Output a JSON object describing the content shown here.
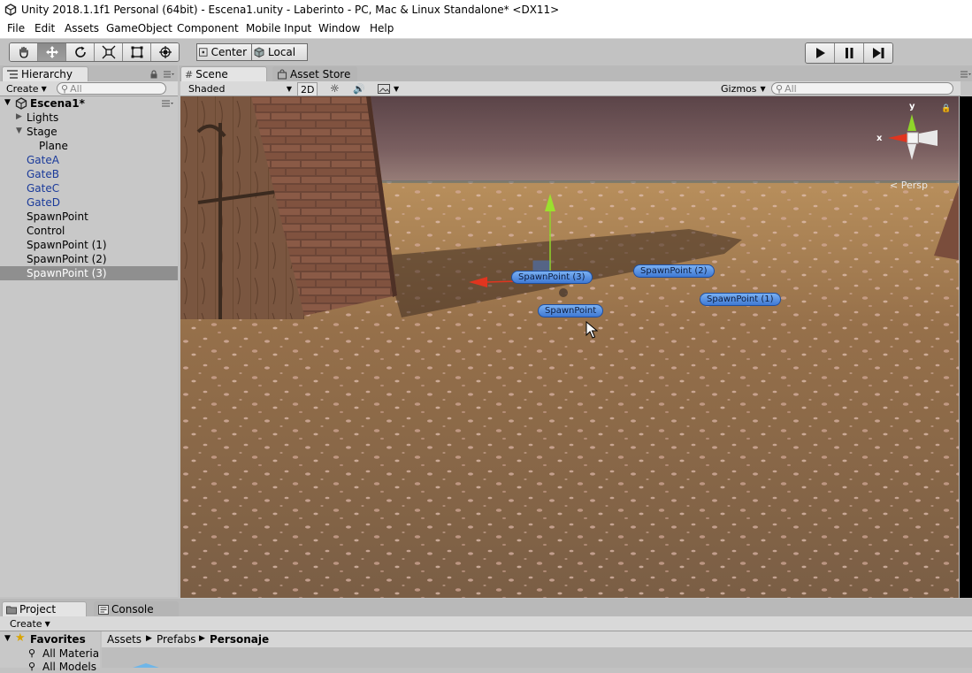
{
  "window": {
    "title": "Unity 2018.1.1f1 Personal (64bit) - Escena1.unity - Laberinto - PC, Mac & Linux Standalone* <DX11>"
  },
  "menu": [
    "File",
    "Edit",
    "Assets",
    "GameObject",
    "Component",
    "Mobile Input",
    "Window",
    "Help"
  ],
  "toolbar": {
    "pivot_mode": "Center",
    "pivot_space": "Local",
    "tools": [
      "hand-tool",
      "move-tool",
      "rotate-tool",
      "scale-tool",
      "rect-tool",
      "transform-tool"
    ],
    "active_tool": "move-tool"
  },
  "hierarchy": {
    "tab": "Hierarchy",
    "create": "Create",
    "search_placeholder": "All",
    "scene": "Escena1*",
    "items": [
      {
        "label": "Lights"
      },
      {
        "label": "Stage"
      },
      {
        "label": "Plane"
      },
      {
        "label": "GateA"
      },
      {
        "label": "GateB"
      },
      {
        "label": "GateC"
      },
      {
        "label": "GateD"
      },
      {
        "label": "SpawnPoint"
      },
      {
        "label": "Control"
      },
      {
        "label": "SpawnPoint (1)"
      },
      {
        "label": "SpawnPoint (2)"
      },
      {
        "label": "SpawnPoint (3)"
      }
    ],
    "selected": "SpawnPoint (3)",
    "prefab_color": "#1a3a9a"
  },
  "scene_view": {
    "tabs": [
      "Scene",
      "Asset Store"
    ],
    "shading": "Shaded",
    "mode_2d": "2D",
    "gizmos": "Gizmos",
    "search_placeholder": "All",
    "projection": "Persp",
    "axis_x": "x",
    "axis_y": "y",
    "spawn_labels": [
      "SpawnPoint (3)",
      "SpawnPoint (2)",
      "SpawnPoint (1)",
      "SpawnPoint"
    ]
  },
  "bottom": {
    "tabs": [
      "Project",
      "Console"
    ],
    "create": "Create",
    "favorites": "Favorites",
    "favorites_items": [
      "All Materials",
      "All Models"
    ],
    "breadcrumb": [
      "Assets",
      "Prefabs",
      "Personaje"
    ]
  },
  "colors": {
    "selection": "#8f8f8f",
    "prefab_text": "#1a3a9a",
    "gizmo_x": "#e0351f",
    "gizmo_y": "#8fd42a",
    "gizmo_z": "#3f79d4",
    "spawn_label": "#5b93e6"
  }
}
